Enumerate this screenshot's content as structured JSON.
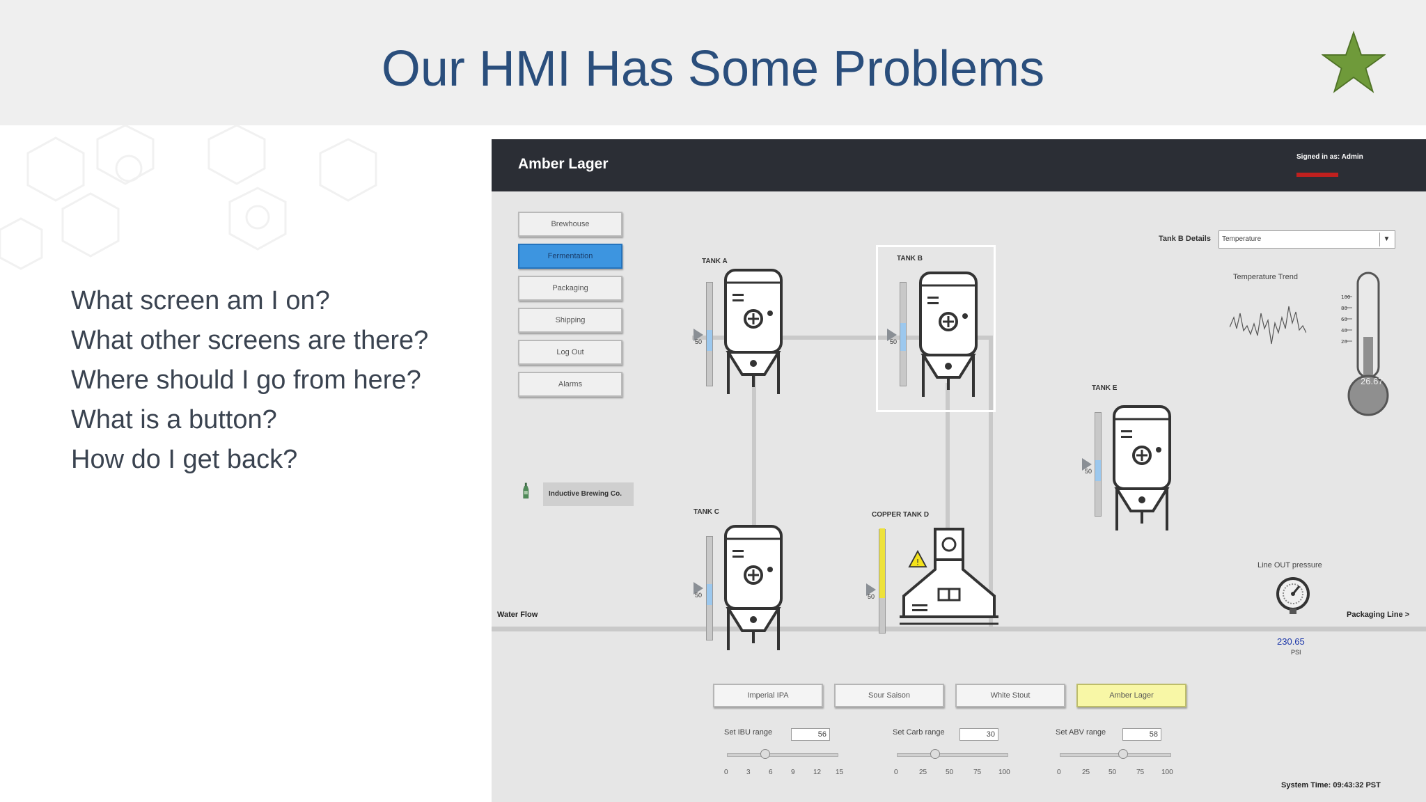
{
  "slide": {
    "title": "Our HMI Has Some Problems",
    "questions": [
      "What screen am I on?",
      "What other screens are there?",
      "Where should I go from here?",
      "What is a button?",
      "How do I get back?"
    ]
  },
  "hmi": {
    "title": "Amber Lager",
    "signed_in": "Signed in as: Admin",
    "nav": [
      "Brewhouse",
      "Fermentation",
      "Packaging",
      "Shipping",
      "Log Out",
      "Alarms"
    ],
    "active_nav": "Fermentation",
    "brand_label": "Inductive Brewing Co.",
    "tanks": {
      "a": {
        "label": "TANK A",
        "level": "50"
      },
      "b": {
        "label": "TANK B",
        "level": "50"
      },
      "c": {
        "label": "TANK C",
        "level": "50"
      },
      "d": {
        "label": "COPPER TANK D",
        "level": "50"
      },
      "e": {
        "label": "TANK E",
        "level": "50"
      }
    },
    "details": {
      "label": "Tank B Details",
      "selected": "Temperature"
    },
    "trend_label": "Temperature Trend",
    "thermometer": {
      "value": "26.67",
      "scale": [
        "100",
        "80",
        "60",
        "40",
        "20"
      ]
    },
    "pressure": {
      "label": "Line OUT pressure",
      "value": "230.65",
      "unit": "PSI"
    },
    "water_flow": "Water Flow",
    "packaging_line": "Packaging Line >",
    "recipes": [
      "Imperial IPA",
      "Sour Saison",
      "White Stout",
      "Amber Lager"
    ],
    "active_recipe": "Amber Lager",
    "sliders": [
      {
        "label": "Set IBU range",
        "value": "56",
        "ticks": [
          "0",
          "3",
          "6",
          "9",
          "12",
          "15"
        ],
        "position": 0.3
      },
      {
        "label": "Set Carb range",
        "value": "30",
        "ticks": [
          "0",
          "25",
          "50",
          "75",
          "100"
        ],
        "position": 0.3
      },
      {
        "label": "Set ABV range",
        "value": "58",
        "ticks": [
          "0",
          "25",
          "50",
          "75",
          "100"
        ],
        "position": 0.58
      }
    ],
    "system_time": "System Time: 09:43:32 PST"
  },
  "colors": {
    "title": "#2a4e7c",
    "star": "#6f9a3a",
    "active_nav": "#3d95e0",
    "active_recipe": "#f8f7a6",
    "header": "#2b2e35",
    "alarm": "#c0201e"
  }
}
